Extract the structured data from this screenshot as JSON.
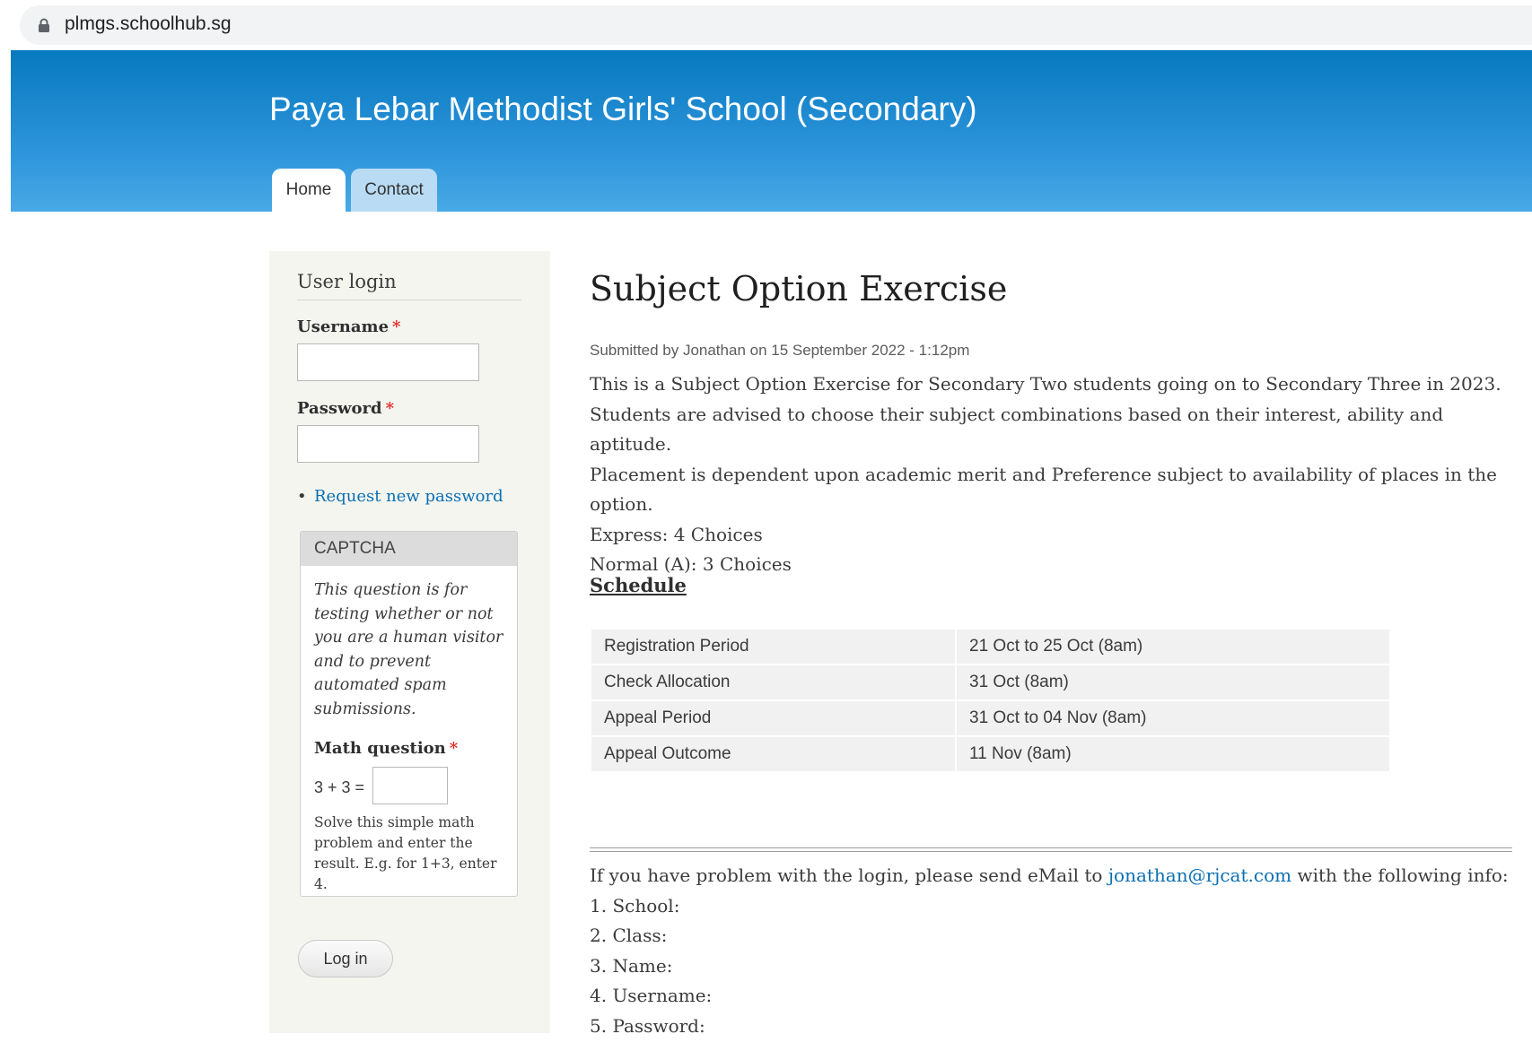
{
  "browser": {
    "url": "plmgs.schoolhub.sg",
    "lock_icon": "lock-icon"
  },
  "header": {
    "site_name": "Paya Lebar Methodist Girls' School (Secondary)",
    "tabs": [
      {
        "label": "Home",
        "active": true
      },
      {
        "label": "Contact",
        "active": false
      }
    ],
    "accent_color": "#0779bf"
  },
  "sidebar": {
    "title": "User login",
    "username_label": "Username",
    "password_label": "Password",
    "required_mark": "*",
    "username_value": "",
    "password_value": "",
    "request_password_link": "Request new password",
    "captcha": {
      "legend": "CAPTCHA",
      "description": "This question is for testing whether or not you are a human visitor and to prevent automated spam submissions.",
      "math_label": "Math question",
      "math_expression": "3 + 3 =",
      "math_value": "",
      "help_text": "Solve this simple math problem and enter the result. E.g. for 1+3, enter 4."
    },
    "login_button": "Log in"
  },
  "main": {
    "title": "Subject Option Exercise",
    "submitted": "Submitted by Jonathan on 15 September 2022 - 1:12pm",
    "paragraphs": [
      "This is a Subject Option Exercise for Secondary Two students going on to Secondary Three in 2023.",
      "Students are advised to choose their subject combinations based on their interest, ability and aptitude.",
      "Placement is dependent upon academic merit and Preference subject to availability of places in the option.",
      "Express: 4 Choices",
      "Normal (A): 3 Choices"
    ],
    "schedule_heading": "Schedule",
    "schedule": [
      {
        "event": "Registration Period",
        "date": "21 Oct to 25 Oct (8am)"
      },
      {
        "event": "Check Allocation",
        "date": "31 Oct (8am)"
      },
      {
        "event": "Appeal Period",
        "date": "31 Oct to 04 Nov (8am)"
      },
      {
        "event": "Appeal Outcome",
        "date": "11 Nov (8am)"
      }
    ],
    "contact": {
      "prefix": "If you have problem with the login, please send eMail to",
      "email": "jonathan@rjcat.com",
      "suffix": "with the following info:",
      "items": [
        "1. School:",
        "2. Class:",
        "3. Name:",
        "4. Username:",
        "5. Password:"
      ]
    },
    "link_color": "#0a6fb4"
  }
}
